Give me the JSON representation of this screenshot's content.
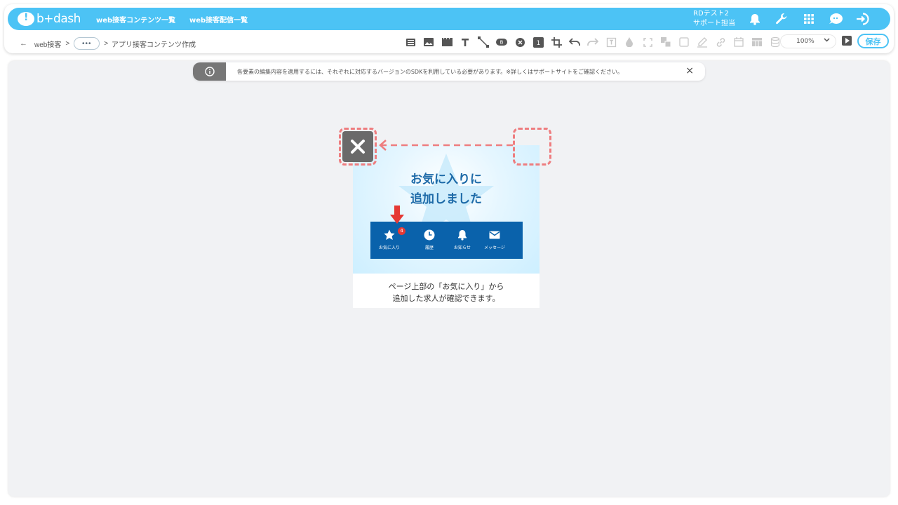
{
  "app": {
    "logo_text": "b+dash",
    "nav": [
      "web接客コンテンツ一覧",
      "web接客配信一覧"
    ],
    "user_line1": "RDテスト2",
    "user_line2": "サポート担当",
    "accent": "#4cc3f5"
  },
  "breadcrumb": {
    "back_icon": "arrow-left-icon",
    "first": "web接客",
    "sep": ">",
    "ellipsis": "•••",
    "current": "アプリ接客コンテンツ作成"
  },
  "toolbar": {
    "zoom": "100%",
    "save_label": "保存",
    "tools": [
      "list",
      "image",
      "video",
      "text",
      "line",
      "button",
      "close",
      "number",
      "crop",
      "undo",
      "redo",
      "frame",
      "drop",
      "expand",
      "layer",
      "checkbox",
      "pen",
      "link",
      "calendar",
      "table",
      "database"
    ]
  },
  "notice": {
    "text": "各要素の編集内容を適用するには、それぞれに対応するバージョンのSDKを利用している必要があります。※詳しくはサポートサイトをご確認ください。"
  },
  "popup": {
    "title_line1": "お気に入りに",
    "title_line2": "追加しました",
    "tabs": [
      "お気に入り",
      "履歴",
      "お知らせ",
      "メッセージ"
    ],
    "badge": "4",
    "desc_line1": "ページ上部の「お気に入り」から",
    "desc_line2": "追加した求人が確認できます。",
    "tabbar_color": "#0a62ab",
    "highlight_color": "#ee7d7f"
  }
}
